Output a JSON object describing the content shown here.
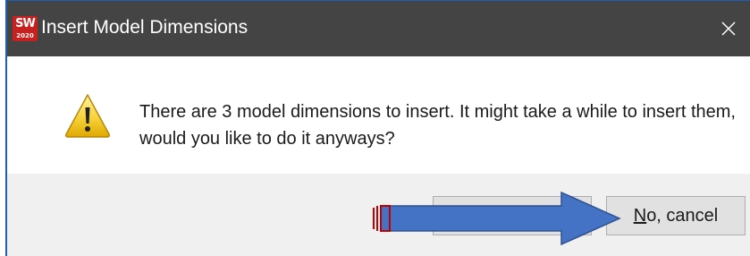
{
  "window": {
    "title": "Insert Model Dimensions",
    "logo_text": "SW",
    "logo_year": "2020",
    "close_glyph": "✕"
  },
  "message": {
    "text": "There are 3 model dimensions to insert. It might take a while to insert them, would you like to do it anyways?",
    "icon": "warning-icon"
  },
  "buttons": {
    "yes_label": "",
    "no_mnemonic": "N",
    "no_rest": "o, cancel"
  },
  "annotation": {
    "arrow_color": "#4472c4",
    "arrow_stroke": "#c00000",
    "arrow_direction": "right"
  },
  "colors": {
    "titlebar": "#444444",
    "footer": "#f0f0f0",
    "window_border": "#1f5fb3",
    "logo_red": "#c8201e"
  }
}
